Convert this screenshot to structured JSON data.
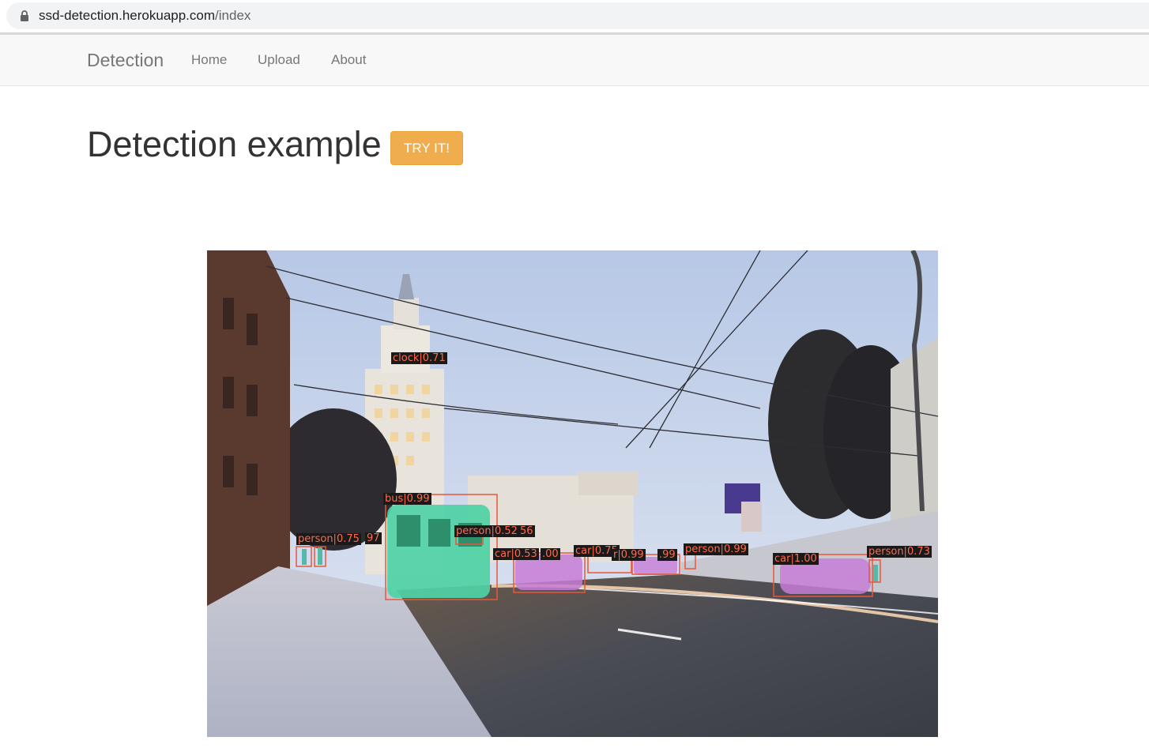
{
  "browser": {
    "url_host": "ssd-detection.herokuapp.com",
    "url_path": "/index"
  },
  "navbar": {
    "brand": "Detection",
    "links": [
      "Home",
      "Upload",
      "About"
    ]
  },
  "main": {
    "title": "Detection example",
    "try_button": "TRY IT!"
  },
  "detections": [
    {
      "label": "clock|0.71"
    },
    {
      "label": "bus|0.99"
    },
    {
      "label": "person|0.75"
    },
    {
      "label": "97"
    },
    {
      "label": "person|0.52"
    },
    {
      "label": "56"
    },
    {
      "label": "car|0.53"
    },
    {
      "label": ".00"
    },
    {
      "label": "car|0.75"
    },
    {
      "label": "r|0.99"
    },
    {
      "label": ".99"
    },
    {
      "label": "person|0.99"
    },
    {
      "label": "car|1.00"
    },
    {
      "label": "person|0.73"
    }
  ],
  "colors": {
    "accent_button": "#f0ad4e",
    "box_stroke": "#e8563a",
    "label_text": "#ff6a4d",
    "bus_mask": "#4fd1a5",
    "car_mask": "#c77dd6"
  },
  "icons": {
    "lock": "lock-icon"
  }
}
